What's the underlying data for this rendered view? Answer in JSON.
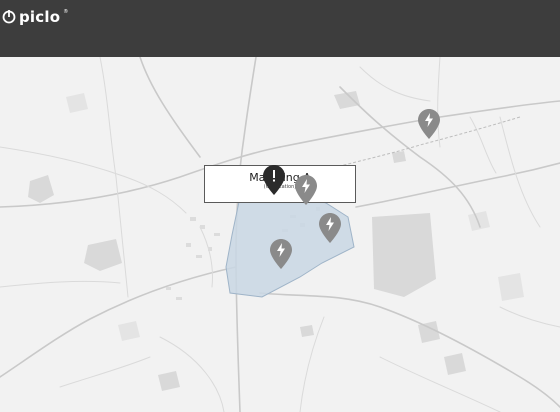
{
  "app": {
    "logo_text": "piclo",
    "logo_reg": "®"
  },
  "colors": {
    "topbar": "#3d3d3d",
    "map_background": "#f2f2f2",
    "area_fill": "#c9d7e4",
    "area_stroke": "#9fb4c8",
    "pin_alert": "#2b2b2b",
    "pin_asset": "#8a8a8a"
  },
  "callout": {
    "title": "Matching A",
    "subtitle": "(On location)"
  },
  "pins": [
    {
      "name": "alert-pin",
      "icon": "exclamation-icon",
      "type": "alert"
    },
    {
      "name": "asset-pin",
      "icon": "lightning-icon",
      "type": "asset"
    },
    {
      "name": "asset-pin",
      "icon": "lightning-icon",
      "type": "asset"
    },
    {
      "name": "asset-pin",
      "icon": "lightning-icon",
      "type": "asset"
    },
    {
      "name": "asset-pin",
      "icon": "lightning-icon",
      "type": "asset"
    }
  ]
}
